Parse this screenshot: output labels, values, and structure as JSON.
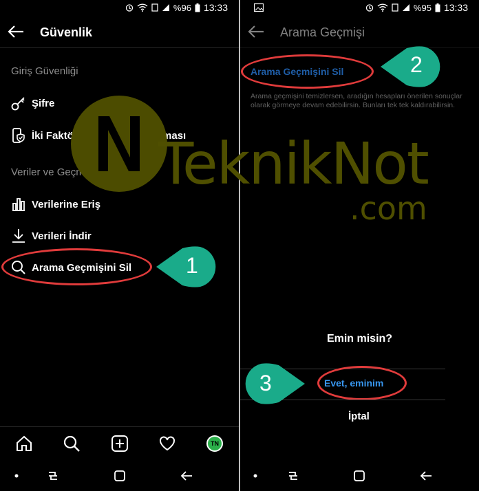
{
  "status_left": {
    "battery_pct": "%96",
    "time": "13:33"
  },
  "status_right": {
    "battery_pct": "%95",
    "time": "13:33"
  },
  "left_screen": {
    "title": "Güvenlik",
    "section1": "Giriş Güvenliği",
    "item_password": "Şifre",
    "item_2fa": "İki Faktörlü Kimlik Doğrulaması",
    "section2": "Veriler ve Geçmiş",
    "item_access": "Verilerine Eriş",
    "item_download": "Verileri İndir",
    "item_clear_history": "Arama Geçmişini Sil",
    "step": "1"
  },
  "right_screen": {
    "title": "Arama Geçmişi",
    "clear_link": "Arama Geçmişini Sil",
    "description": "Arama geçmişini temizlersen, aradığın hesapları önerilen sonuçlar olarak görmeye devam edebilirsin. Bunları tek tek kaldırabilirsin.",
    "dialog_title": "Emin misin?",
    "confirm": "Evet, eminim",
    "cancel": "İptal",
    "step2": "2",
    "step3": "3"
  },
  "watermark": {
    "word1": "Teknik",
    "word2": "Not",
    "suffix": ".com",
    "logo_letter": "N"
  },
  "avatar_initials": "TN",
  "colors": {
    "callout": "#1aab8a",
    "highlight": "#e03b3b",
    "link": "#3897f0",
    "watermark": "#5a5a00"
  }
}
